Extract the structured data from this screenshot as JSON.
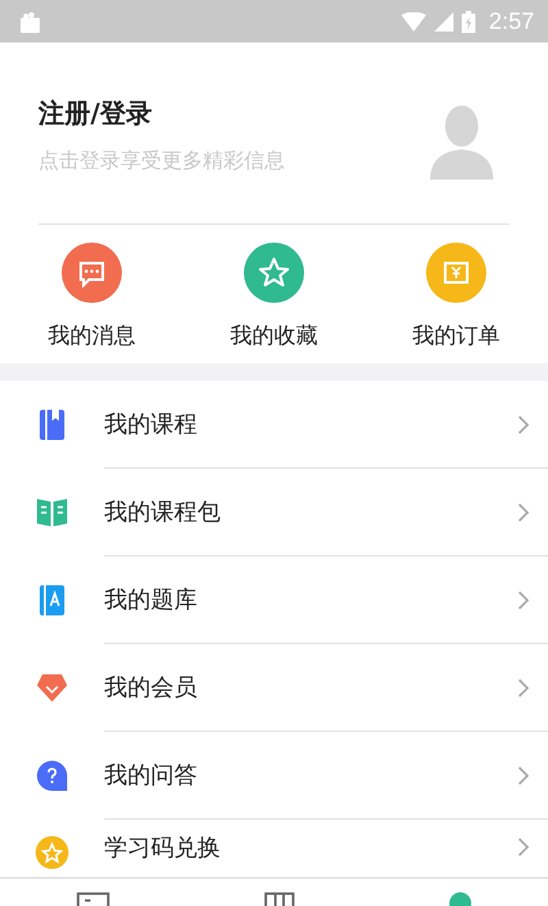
{
  "status_bar": {
    "time": "2:57"
  },
  "profile": {
    "title": "注册/登录",
    "subtitle": "点击登录享受更多精彩信息"
  },
  "shortcuts": [
    {
      "label": "我的消息",
      "kind": "message",
      "color": "#f26c4f"
    },
    {
      "label": "我的收藏",
      "kind": "star",
      "color": "#2fba8f"
    },
    {
      "label": "我的订单",
      "kind": "order",
      "color": "#f5b818"
    }
  ],
  "menu": [
    {
      "label": "我的课程",
      "kind": "course"
    },
    {
      "label": "我的课程包",
      "kind": "package"
    },
    {
      "label": "我的题库",
      "kind": "bank"
    },
    {
      "label": "我的会员",
      "kind": "vip"
    },
    {
      "label": "我的问答",
      "kind": "qa"
    },
    {
      "label": "学习码兑换",
      "kind": "code"
    }
  ],
  "tabs": [
    {
      "kind": "home",
      "selected": false
    },
    {
      "kind": "library",
      "selected": false
    },
    {
      "kind": "me",
      "selected": true
    }
  ]
}
